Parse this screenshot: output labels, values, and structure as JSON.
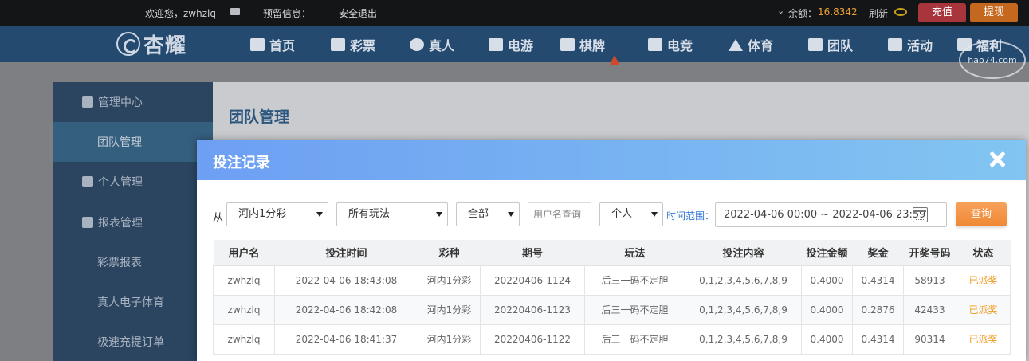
{
  "topbar": {
    "welcome": "欢迎您，zwhzlq",
    "notice_label": "预留信息：",
    "logout": "安全退出",
    "balance_label": "余额：",
    "balance_value": "16.8342",
    "refresh": "刷新",
    "recharge": "充值",
    "withdraw": "提现"
  },
  "nav": {
    "logo": "杏耀",
    "items": [
      "首页",
      "彩票",
      "真人",
      "电游",
      "棋牌",
      "电竞",
      "体育",
      "团队",
      "活动",
      "福利"
    ],
    "watermark": "hao74.com"
  },
  "sidebar": {
    "management_center": "管理中心",
    "team_management": "团队管理",
    "personal_management": "个人管理",
    "report_management": "报表管理",
    "lottery_report": "彩票报表",
    "live_esports": "真人电子体育",
    "fast_recharge": "极速充提订单"
  },
  "page_title": "团队管理",
  "modal": {
    "title": "投注记录",
    "filters": {
      "from_label": "从",
      "lottery": "河内1分彩",
      "play": "所有玩法",
      "status": "全部",
      "username_placeholder": "用户名查询",
      "scope": "个人",
      "time_label": "时间范围：",
      "date_range": "2022-04-06 00:00 ~ 2022-04-06 23:59",
      "query": "查询"
    },
    "columns": [
      "用户名",
      "投注时间",
      "彩种",
      "期号",
      "玩法",
      "投注内容",
      "投注金额",
      "奖金",
      "开奖号码",
      "状态"
    ],
    "rows": [
      [
        "zwhzlq",
        "2022-04-06 18:43:08",
        "河内1分彩",
        "20220406-1124",
        "后三一码不定胆",
        "0,1,2,3,4,5,6,7,8,9",
        "0.4000",
        "0.4314",
        "58913",
        "已派奖"
      ],
      [
        "zwhzlq",
        "2022-04-06 18:42:08",
        "河内1分彩",
        "20220406-1123",
        "后三一码不定胆",
        "0,1,2,3,4,5,6,7,8,9",
        "0.4000",
        "0.2876",
        "42433",
        "已派奖"
      ],
      [
        "zwhzlq",
        "2022-04-06 18:41:37",
        "河内1分彩",
        "20220406-1122",
        "后三一码不定胆",
        "0,1,2,3,4,5,6,7,8,9",
        "0.4000",
        "0.4314",
        "90314",
        "已派奖"
      ]
    ]
  },
  "colors": {
    "topbar_bg": "#141517",
    "nav_bg": "#244a70",
    "recharge_btn": "#a9353c",
    "withdraw_btn": "#c4681f",
    "balance": "#f0a030",
    "modal_header_start": "#6d9ff3",
    "modal_header_end": "#82c5f1",
    "query_btn": "#ef8834",
    "status_paid": "#f09a1f"
  }
}
